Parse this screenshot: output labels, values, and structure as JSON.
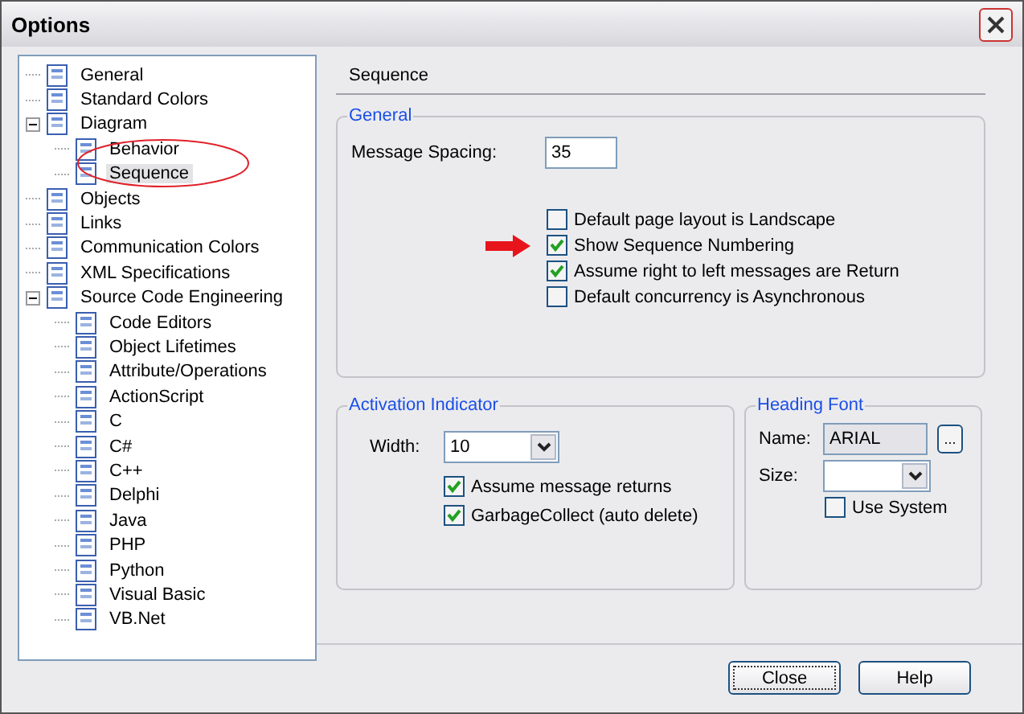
{
  "window": {
    "title": "Options"
  },
  "tree": [
    {
      "label": "General",
      "selected": false
    },
    {
      "label": "Standard Colors",
      "selected": false
    },
    {
      "label": "Diagram",
      "selected": false,
      "expanded": true,
      "children": [
        {
          "label": "Behavior",
          "selected": false
        },
        {
          "label": "Sequence",
          "selected": true
        }
      ]
    },
    {
      "label": "Objects",
      "selected": false
    },
    {
      "label": "Links",
      "selected": false
    },
    {
      "label": "Communication Colors",
      "selected": false
    },
    {
      "label": "XML Specifications",
      "selected": false
    },
    {
      "label": "Source Code Engineering",
      "selected": false,
      "expanded": true,
      "children": [
        {
          "label": "Code Editors",
          "selected": false
        },
        {
          "label": "Object Lifetimes",
          "selected": false
        },
        {
          "label": "Attribute/Operations",
          "selected": false
        },
        {
          "label": "ActionScript",
          "selected": false
        },
        {
          "label": "C",
          "selected": false
        },
        {
          "label": "C#",
          "selected": false
        },
        {
          "label": "C++",
          "selected": false
        },
        {
          "label": "Delphi",
          "selected": false
        },
        {
          "label": "Java",
          "selected": false
        },
        {
          "label": "PHP",
          "selected": false
        },
        {
          "label": "Python",
          "selected": false
        },
        {
          "label": "Visual Basic",
          "selected": false
        },
        {
          "label": "VB.Net",
          "selected": false
        }
      ]
    }
  ],
  "page": {
    "title": "Sequence"
  },
  "general": {
    "title": "General",
    "message_spacing": {
      "label": "Message Spacing:",
      "value": "35"
    },
    "options": [
      {
        "label": "Default page layout is Landscape",
        "checked": false
      },
      {
        "label": "Show Sequence Numbering",
        "checked": true
      },
      {
        "label": "Assume right to left messages are Return",
        "checked": true
      },
      {
        "label": "Default concurrency is Asynchronous",
        "checked": false
      }
    ]
  },
  "activation": {
    "title": "Activation Indicator",
    "width": {
      "label": "Width:",
      "value": "10"
    },
    "options": [
      {
        "label": "Assume message returns",
        "checked": true
      },
      {
        "label": "GarbageCollect (auto delete)",
        "checked": true
      }
    ]
  },
  "heading_font": {
    "title": "Heading Font",
    "name": {
      "label": "Name:",
      "value": "ARIAL"
    },
    "browse": "...",
    "size": {
      "label": "Size:"
    },
    "use_system": {
      "label": "Use System",
      "checked": false
    }
  },
  "buttons": [
    "Close",
    "Help"
  ]
}
